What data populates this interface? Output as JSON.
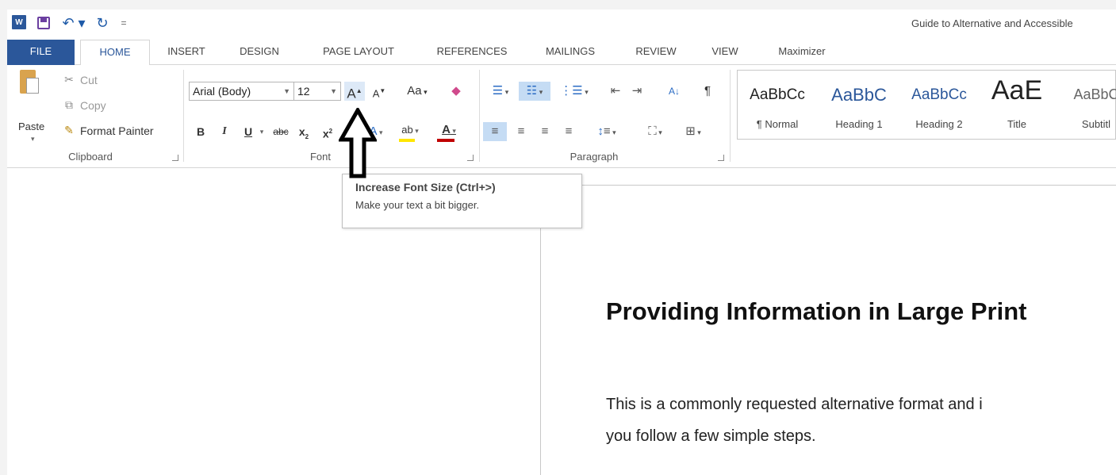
{
  "title_bar": {
    "app_logo": "W",
    "icons": [
      "word-icon",
      "save-icon",
      "undo-icon",
      "redo-icon",
      "customize-qat-icon"
    ],
    "undo_glyph": "↶ ▾",
    "redo_glyph": "↻",
    "more_glyph": "=",
    "document_title": "Guide to Alternative and Accessible"
  },
  "tabs": [
    "FILE",
    "HOME",
    "INSERT",
    "DESIGN",
    "PAGE LAYOUT",
    "REFERENCES",
    "MAILINGS",
    "REVIEW",
    "VIEW",
    "Maximizer"
  ],
  "active_tab": "HOME",
  "ribbon": {
    "clipboard": {
      "paste": "Paste",
      "cut": "Cut",
      "copy": "Copy",
      "format_painter": "Format Painter",
      "label": "Clipboard"
    },
    "font": {
      "font_name": "Arial (Body)",
      "font_size": "12",
      "grow_glyph": "A",
      "shrink_glyph": "A",
      "change_case": "Aa",
      "bold": "B",
      "italic": "I",
      "underline": "U",
      "strikethrough": "abc",
      "subscript": "x",
      "superscript": "x",
      "highlight": "ab",
      "font_color": "A",
      "label": "Font"
    },
    "paragraph": {
      "label": "Paragraph",
      "pilcrow": "¶",
      "sort": "A↓"
    },
    "styles": [
      {
        "sample": "AaBbCc",
        "name": "¶ Normal"
      },
      {
        "sample": "AaBbC",
        "name": "Heading 1"
      },
      {
        "sample": "AaBbCc",
        "name": "Heading 2"
      },
      {
        "sample": "AaE",
        "name": "Title"
      },
      {
        "sample": "AaBbC",
        "name": "Subtitl"
      }
    ]
  },
  "tooltip": {
    "title": "Increase Font Size (Ctrl+>)",
    "description": "Make your text a bit bigger."
  },
  "document": {
    "heading": "Providing Information in Large Print",
    "lines": [
      "This is a commonly requested alternative format and i",
      "you follow a few simple steps."
    ]
  },
  "colors": {
    "accent": "#2b579a",
    "highlight_yellow": "#ffe600",
    "font_red": "#c00000"
  }
}
